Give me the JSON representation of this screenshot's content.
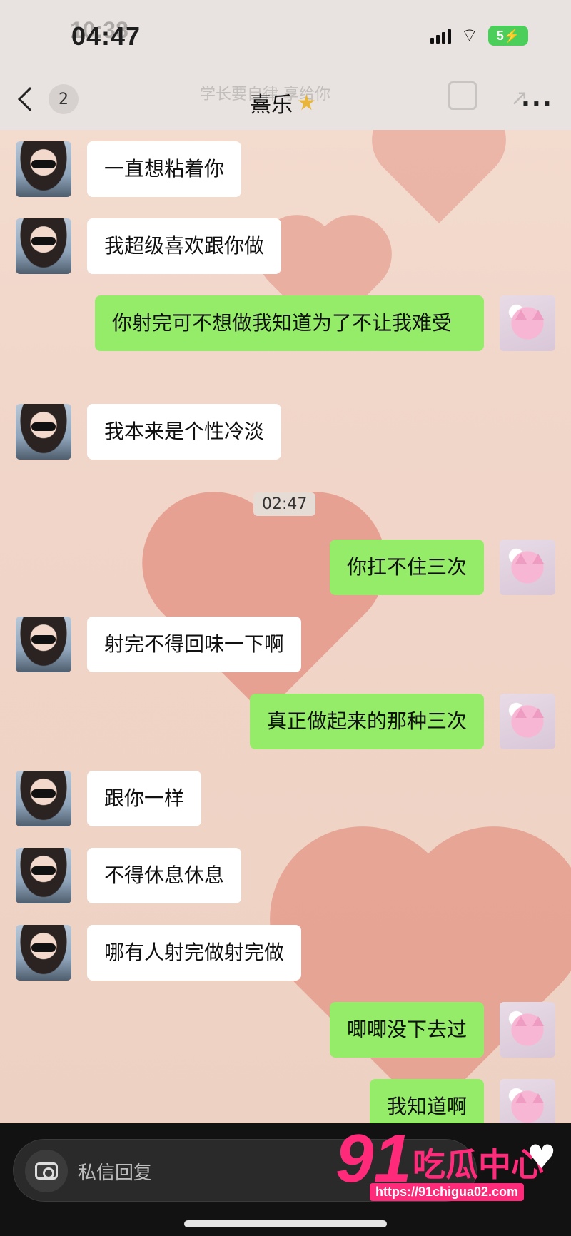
{
  "status_bar": {
    "time": "04:47",
    "time_ghost": "10:38",
    "battery_level": "5"
  },
  "header": {
    "unread_count": "2",
    "ghost_caption": "学长要自律 享给你",
    "title": "熹乐"
  },
  "messages": [
    {
      "side": "in",
      "text": "一直想粘着你"
    },
    {
      "side": "in",
      "text": "我超级喜欢跟你做"
    },
    {
      "side": "out",
      "text": "你射完可不想做我知道为了不让我难受"
    },
    {
      "side": "in",
      "text": "我本来是个性冷淡"
    },
    {
      "side": "out",
      "text": "你扛不住三次"
    },
    {
      "side": "in",
      "text": "射完不得回味一下啊"
    },
    {
      "side": "out",
      "text": "真正做起来的那种三次"
    },
    {
      "side": "in",
      "text": "跟你一样"
    },
    {
      "side": "in",
      "text": "不得休息休息"
    },
    {
      "side": "in",
      "text": "哪有人射完做射完做"
    },
    {
      "side": "out",
      "text": "唧唧没下去过"
    },
    {
      "side": "out",
      "text": "我知道啊"
    }
  ],
  "timestamp": "02:47",
  "bottom_bar": {
    "reply_placeholder": "私信回复"
  },
  "watermark": {
    "number": "91",
    "text": "吃瓜中心",
    "url": "https://91chigua02.com"
  },
  "colors": {
    "incoming_bubble": "#ffffff",
    "outgoing_bubble": "#95ec69",
    "watermark": "#ff2a7a"
  }
}
